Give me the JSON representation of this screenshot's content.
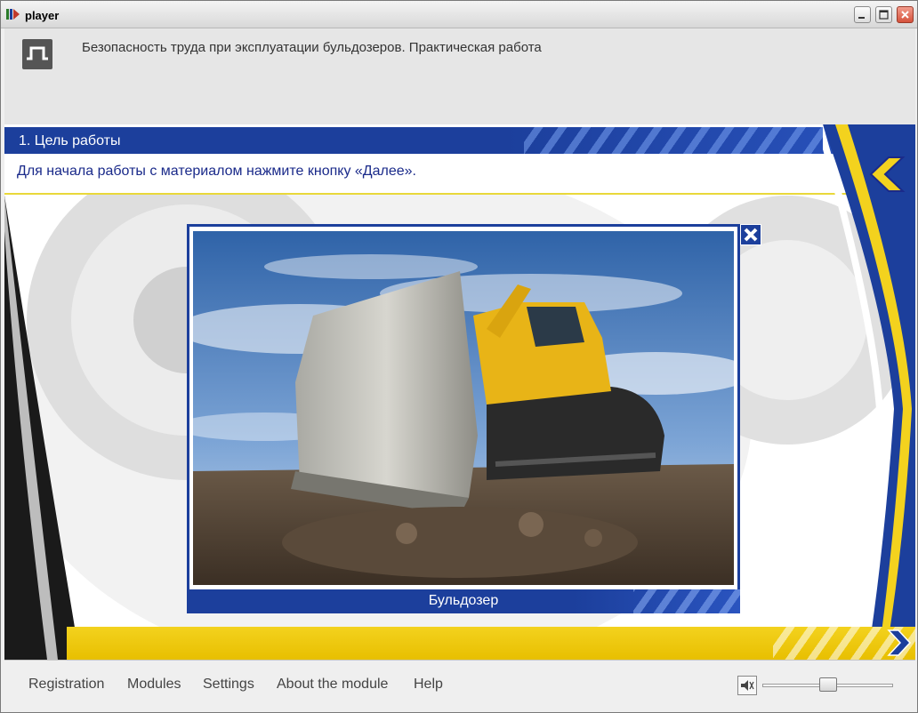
{
  "window": {
    "title": "player",
    "buttons": [
      "minimize",
      "maximize",
      "close"
    ]
  },
  "header": {
    "course_title": "Безопасность труда при эксплуатации бульдозеров. Практическая работа"
  },
  "section": {
    "title": "1. Цель работы",
    "instruction": "Для начала работы с материалом нажмите кнопку «Далее»."
  },
  "popup": {
    "caption": "Бульдозер",
    "image_subject": "bulldozer"
  },
  "footer": {
    "menu": [
      {
        "label": "Registration"
      },
      {
        "label": "Modules"
      },
      {
        "label": "Settings"
      },
      {
        "label": "About the module"
      },
      {
        "label": "Help"
      }
    ],
    "volume_level": 0.5
  },
  "colors": {
    "brand_blue": "#1c3f9c",
    "accent_yellow": "#f3d21e",
    "instruction_text": "#1a2a8a"
  },
  "icons": {
    "app": "player-app-icon",
    "logo": "course-logo-icon",
    "back": "back-arrow-icon",
    "next": "next-arrow-icon",
    "popup_close": "close-icon",
    "volume": "speaker-icon"
  }
}
